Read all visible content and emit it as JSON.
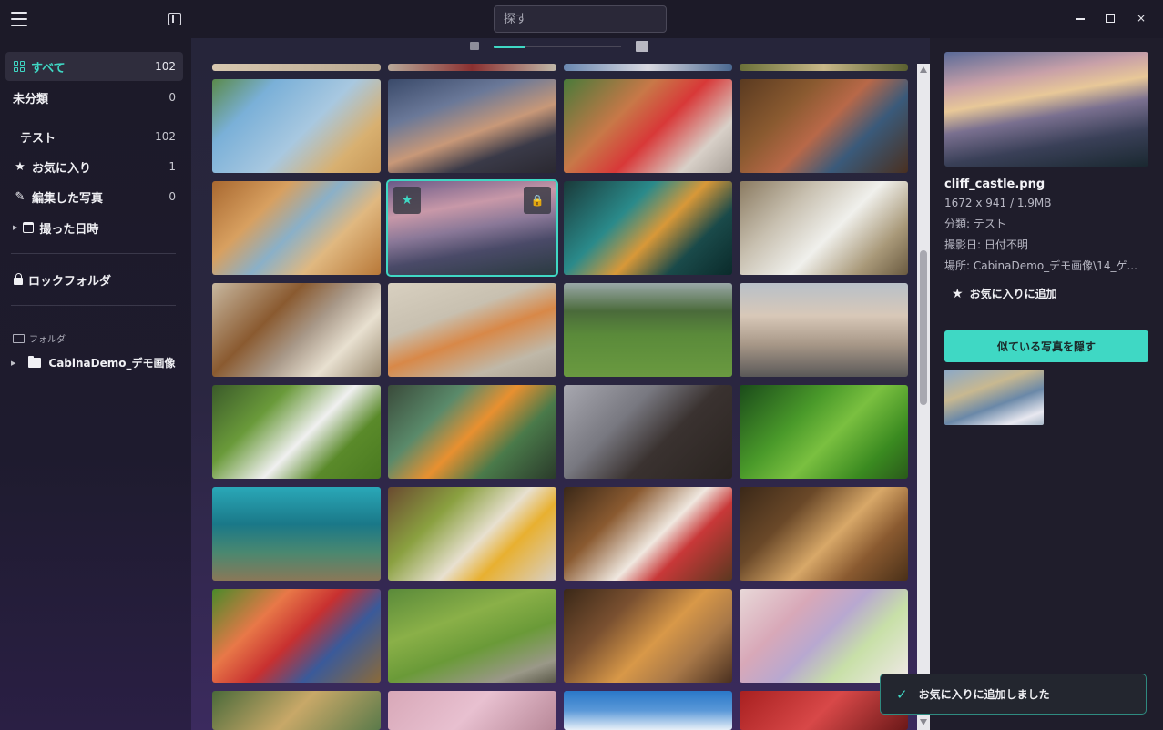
{
  "titlebar": {
    "search_placeholder": "探す",
    "hamburger_icon": "hamburger-menu-icon",
    "sidebar_toggle_icon": "sidebar-toggle-icon",
    "close_glyph": "×"
  },
  "sidebar": {
    "all": {
      "label": "すべて",
      "count": "102"
    },
    "uncategorized": {
      "label": "未分類",
      "count": "0"
    },
    "test": {
      "label": "テスト",
      "count": "102"
    },
    "favorites": {
      "label": "お気に入り",
      "count": "1"
    },
    "edited": {
      "label": "編集した写真",
      "count": "0"
    },
    "date_taken": {
      "label": "撮った日時"
    },
    "lock_folder": {
      "label": "ロックフォルダ"
    },
    "folders_heading": "フォルダ",
    "folder": {
      "label": "CabinaDemo_デモ画像"
    }
  },
  "gallery": {
    "zoom_level": 0.25,
    "accent_color": "#3fd8c4",
    "selected_index": 5,
    "badges": {
      "star": "★",
      "lock": "🔒"
    }
  },
  "panel": {
    "filename": "cliff_castle.png",
    "dimensions": "1672 x 941 / 1.9MB",
    "category": "分類: テスト",
    "date": "撮影日: 日付不明",
    "location": "場所: CabinaDemo_デモ画像\\14_ゲ...",
    "favorite_label": "お気に入りに追加",
    "hide_similar_label": "似ている写真を隠す"
  },
  "toast": {
    "message": "お気に入りに追加しました"
  }
}
